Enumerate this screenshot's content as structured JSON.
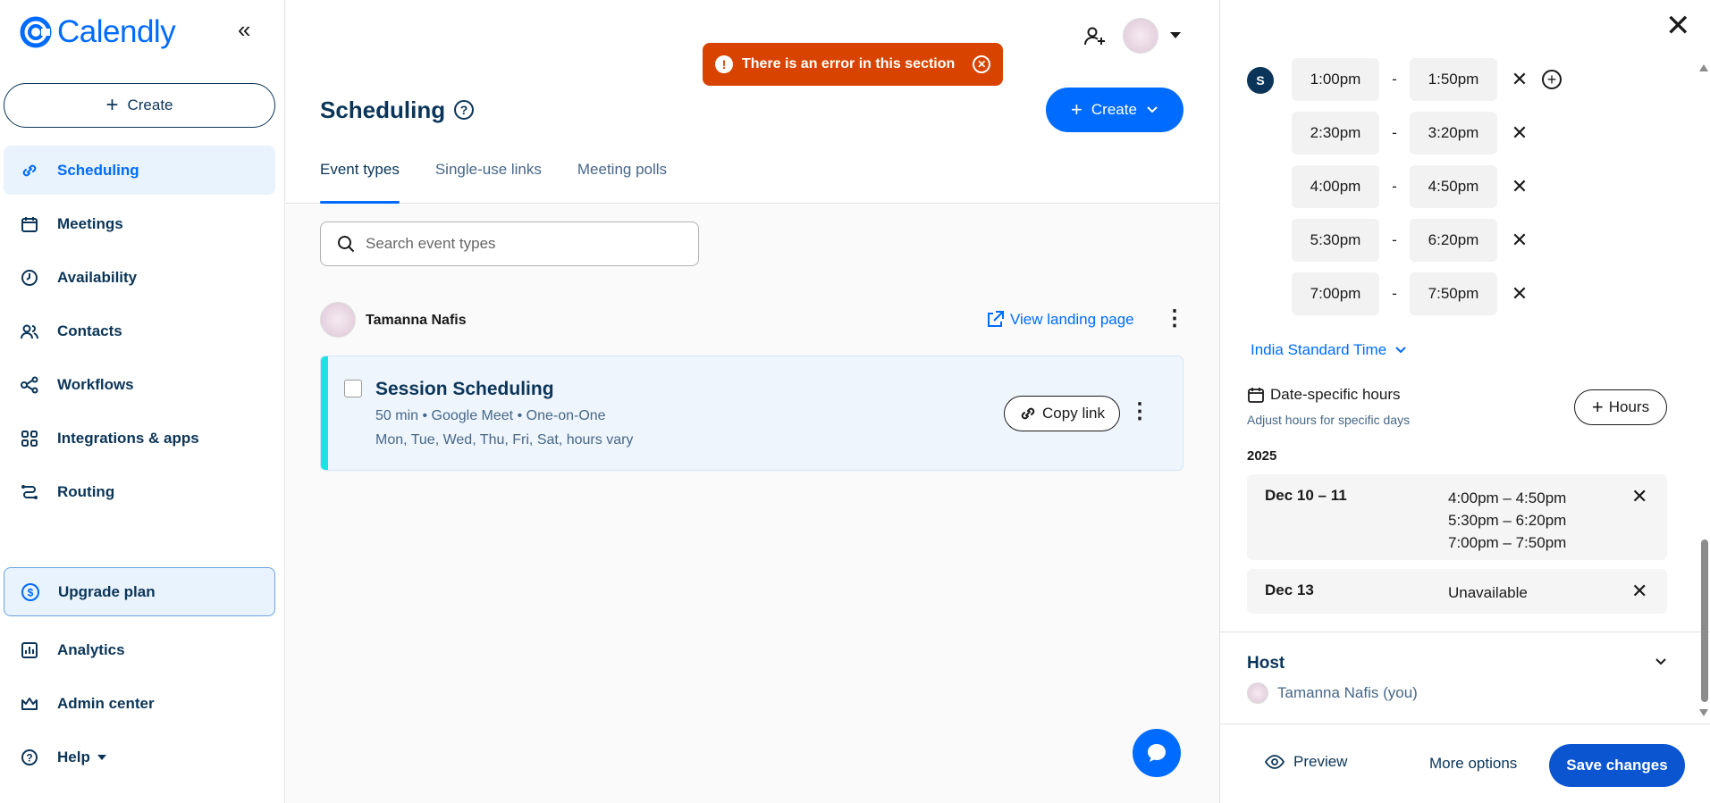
{
  "sidebar": {
    "logo_text": "Calendly",
    "create_label": "Create",
    "nav": [
      {
        "label": "Scheduling"
      },
      {
        "label": "Meetings"
      },
      {
        "label": "Availability"
      },
      {
        "label": "Contacts"
      },
      {
        "label": "Workflows"
      },
      {
        "label": "Integrations & apps"
      },
      {
        "label": "Routing"
      }
    ],
    "upgrade_label": "Upgrade plan",
    "bottom": [
      {
        "label": "Analytics"
      },
      {
        "label": "Admin center"
      },
      {
        "label": "Help"
      }
    ]
  },
  "main": {
    "title": "Scheduling",
    "error_text": "There is an error in this section",
    "create_label": "Create",
    "tabs": [
      {
        "label": "Event types"
      },
      {
        "label": "Single-use links"
      },
      {
        "label": "Meeting polls"
      }
    ],
    "search_placeholder": "Search event types",
    "owner_name": "Tamanna Nafis",
    "landing_label": "View landing page",
    "event": {
      "title": "Session Scheduling",
      "meta": "50 min • Google Meet • One-on-One",
      "days": "Mon, Tue, Wed, Thu, Fri, Sat, hours vary",
      "copy_label": "Copy link"
    }
  },
  "panel": {
    "day_letter": "S",
    "slots": [
      {
        "start": "1:00pm",
        "end": "1:50pm"
      },
      {
        "start": "2:30pm",
        "end": "3:20pm"
      },
      {
        "start": "4:00pm",
        "end": "4:50pm"
      },
      {
        "start": "5:30pm",
        "end": "6:20pm"
      },
      {
        "start": "7:00pm",
        "end": "7:50pm"
      }
    ],
    "dash": "-",
    "timezone": "India Standard Time",
    "date_specific_title": "Date-specific hours",
    "date_specific_sub": "Adjust hours for specific days",
    "hours_btn": "Hours",
    "year": "2025",
    "date_rows": [
      {
        "date": "Dec 10 – 11",
        "times": [
          "4:00pm – 4:50pm",
          "5:30pm – 6:20pm",
          "7:00pm – 7:50pm"
        ]
      },
      {
        "date": "Dec 13",
        "times": [
          "Unavailable"
        ]
      }
    ],
    "host_title": "Host",
    "host_name": "Tamanna Nafis (you)",
    "footer": {
      "preview": "Preview",
      "more_options": "More options",
      "save": "Save changes"
    }
  },
  "colors": {
    "brand": "#006bff",
    "navy": "#0b3558",
    "error": "#d84400",
    "event_accent": "#1ae3e3",
    "save": "#0b56d0"
  }
}
